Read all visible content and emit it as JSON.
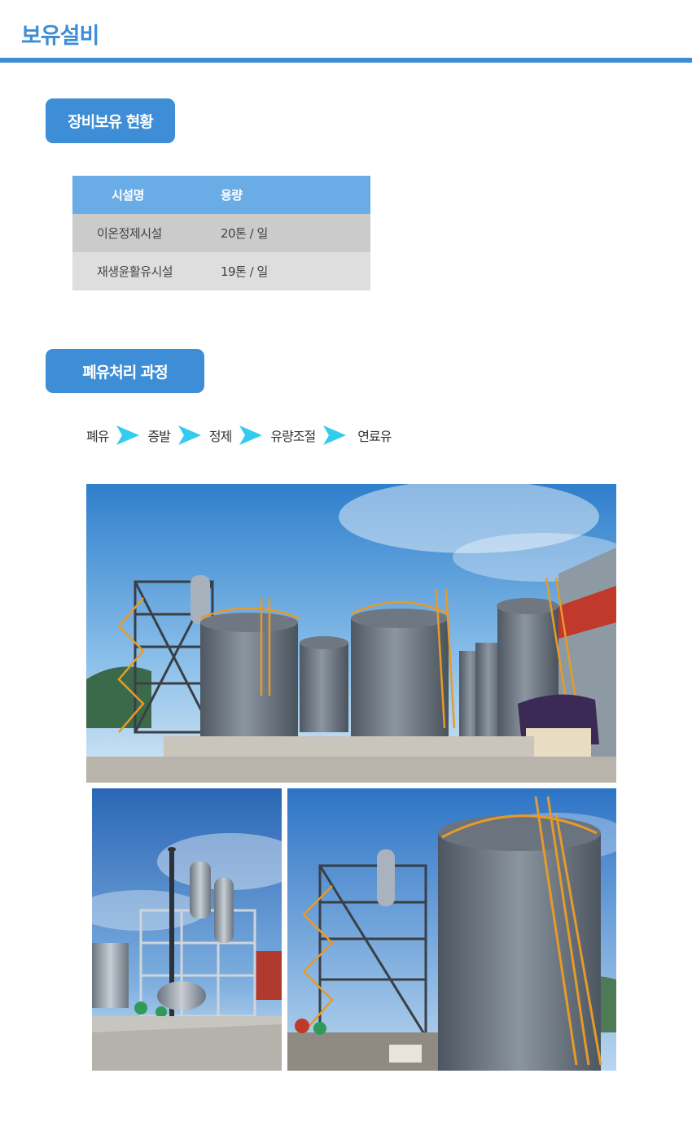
{
  "header": {
    "title": "보유설비"
  },
  "equipment": {
    "badge": "장비보유 현황",
    "columns": [
      "시설명",
      "용량"
    ],
    "rows": [
      {
        "name": "이온정제시설",
        "capacity": "20톤 / 일"
      },
      {
        "name": "재생윤활유시설",
        "capacity": "19톤 / 일"
      }
    ]
  },
  "process": {
    "badge": "폐유처리 과정",
    "steps": [
      "폐유",
      "증발",
      "정제",
      "유량조절",
      "연료유"
    ]
  },
  "colors": {
    "accent": "#3d8ed6",
    "table_header": "#6aace6",
    "arrow": "#33ccee"
  },
  "photos": [
    {
      "icon": "refinery-tanks-photo"
    },
    {
      "icon": "evaporation-tower-photo"
    },
    {
      "icon": "storage-tank-photo"
    }
  ]
}
